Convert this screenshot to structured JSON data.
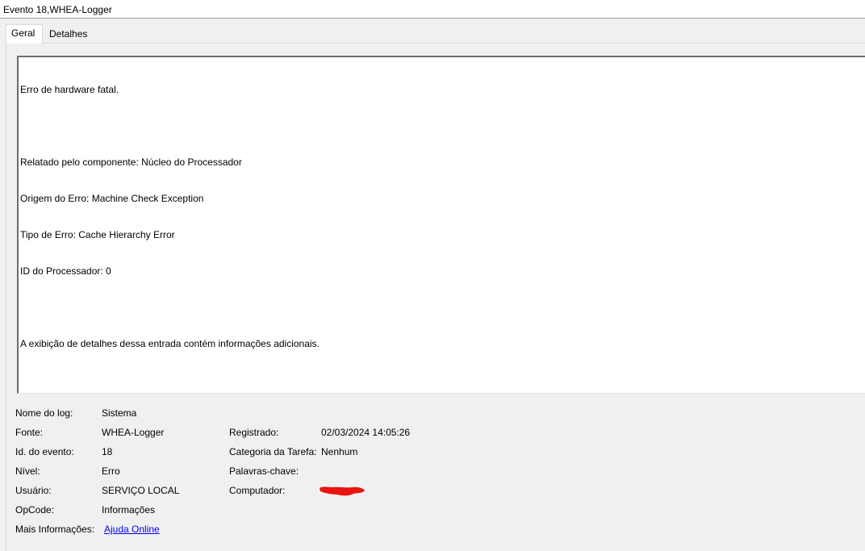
{
  "window": {
    "title": "Evento 18,WHEA-Logger"
  },
  "tabs": [
    {
      "label": "Geral",
      "active": true
    },
    {
      "label": "Detalhes",
      "active": false
    }
  ],
  "description": {
    "lines": [
      "Erro de hardware fatal.",
      "",
      "Relatado pelo componente: Núcleo do Processador",
      "Origem do Erro: Machine Check Exception",
      "Tipo de Erro: Cache Hierarchy Error",
      "ID do Processador: 0",
      "",
      "A exibição de detalhes dessa entrada contém informações adicionais."
    ]
  },
  "details": {
    "log_name": {
      "label": "Nome do log:",
      "value": "Sistema"
    },
    "source": {
      "label": "Fonte:",
      "value": "WHEA-Logger"
    },
    "event_id": {
      "label": "Id. do evento:",
      "value": "18"
    },
    "level": {
      "label": "Nível:",
      "value": "Erro"
    },
    "user": {
      "label": "Usuário:",
      "value": "SERVIÇO LOCAL"
    },
    "opcode": {
      "label": "OpCode:",
      "value": "Informações"
    },
    "more_info": {
      "label": "Mais Informações:",
      "value": "Ajuda Online"
    },
    "logged": {
      "label": "Registrado:",
      "value": "02/03/2024 14:05:26"
    },
    "task_category": {
      "label": "Categoria da Tarefa:",
      "value": "Nenhum"
    },
    "keywords": {
      "label": "Palavras-chave:",
      "value": ""
    },
    "computer": {
      "label": "Computador:",
      "value": ""
    }
  },
  "colors": {
    "link": "#0000ee",
    "redaction": "#e8140f"
  }
}
